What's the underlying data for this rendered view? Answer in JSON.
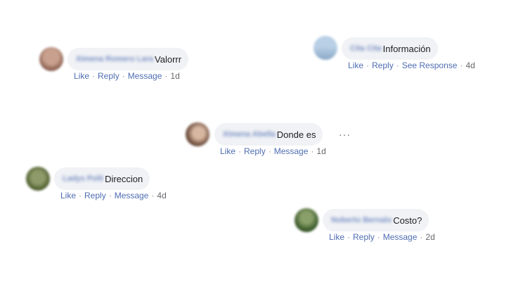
{
  "comments": [
    {
      "name": "Ximena Romero Lara",
      "text": "Valorrr",
      "actions": [
        "Like",
        "Reply",
        "Message"
      ],
      "time": "1d",
      "avatar_color": "#a07a6a"
    },
    {
      "name": "Cita Cita",
      "text": "Información",
      "actions": [
        "Like",
        "Reply",
        "See Response"
      ],
      "time": "4d",
      "avatar_color": "#9ab7d6"
    },
    {
      "name": "Ximena Abella",
      "text": "Donde es",
      "actions": [
        "Like",
        "Reply",
        "Message"
      ],
      "time": "1d",
      "avatar_color": "#7a5a4a",
      "more": "···"
    },
    {
      "name": "Ladys Polli",
      "text": "Direccion",
      "actions": [
        "Like",
        "Reply",
        "Message"
      ],
      "time": "4d",
      "avatar_color": "#5a6a3a"
    },
    {
      "name": "Noberto Bernalo",
      "text": "Costo?",
      "actions": [
        "Like",
        "Reply",
        "Message"
      ],
      "time": "2d",
      "avatar_color": "#4a6a3a"
    }
  ],
  "separator": "·"
}
